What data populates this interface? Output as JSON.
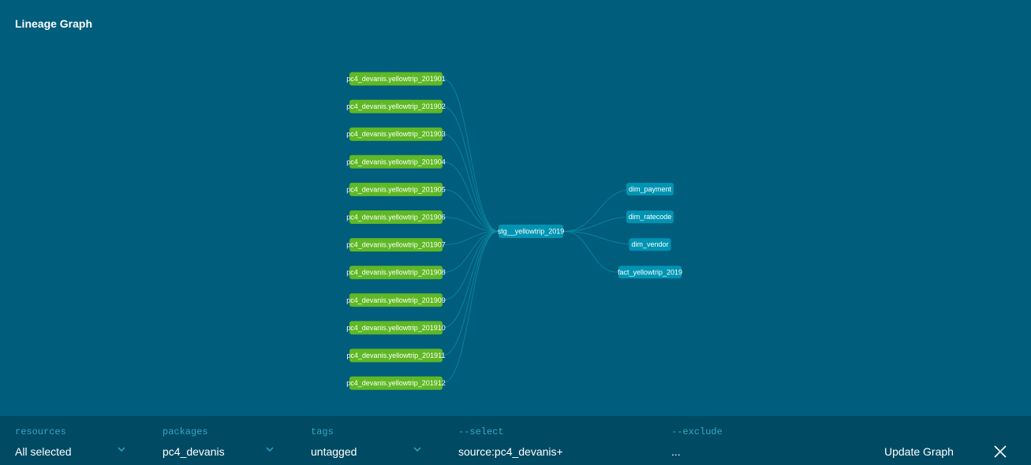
{
  "title": "Lineage Graph",
  "colors": {
    "background": "#005d7c",
    "source_node": "#5fb825",
    "model_node": "#0094b3",
    "edge": "#0f8fa7",
    "bottom_bar": "#004a63",
    "filter_label": "#34a7c7"
  },
  "graph": {
    "sources": [
      "pc4_devanis.yellowtrip_201901",
      "pc4_devanis.yellowtrip_201902",
      "pc4_devanis.yellowtrip_201903",
      "pc4_devanis.yellowtrip_201904",
      "pc4_devanis.yellowtrip_201905",
      "pc4_devanis.yellowtrip_201906",
      "pc4_devanis.yellowtrip_201907",
      "pc4_devanis.yellowtrip_201908",
      "pc4_devanis.yellowtrip_201909",
      "pc4_devanis.yellowtrip_201910",
      "pc4_devanis.yellowtrip_201911",
      "pc4_devanis.yellowtrip_201912"
    ],
    "staging": "stg__yellowtrip_2019",
    "outputs": [
      "dim_payment",
      "dim_ratecode",
      "dim_vendor",
      "fact_yellowtrip_2019"
    ]
  },
  "filters": {
    "resources": {
      "label": "resources",
      "value": "All selected"
    },
    "packages": {
      "label": "packages",
      "value": "pc4_devanis"
    },
    "tags": {
      "label": "tags",
      "value": "untagged"
    },
    "select": {
      "label": "--select",
      "value": "source:pc4_devanis+"
    },
    "exclude": {
      "label": "--exclude",
      "value": "..."
    }
  },
  "update_button": "Update Graph",
  "icons": {
    "dropdown": "chevron-down-icon",
    "close": "close-icon"
  }
}
